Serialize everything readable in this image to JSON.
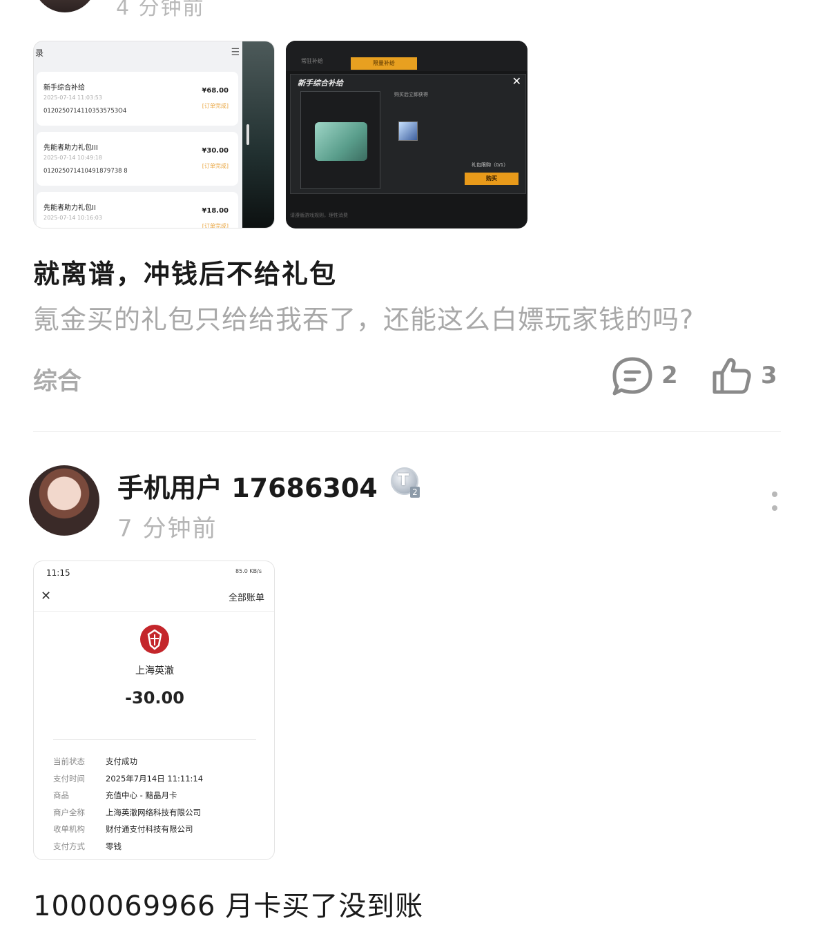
{
  "post1": {
    "time": "4 分钟前",
    "title": "就离谱，冲钱后不给礼包",
    "body": "氪金买的礼包只给给我吞了，还能这么白嫖玩家钱的吗?",
    "category": "综合",
    "comments": "2",
    "likes": "3",
    "image1": {
      "header_label": "录",
      "orders": [
        {
          "name": "新手综合补给",
          "date": "2025-07-14 11:03:53",
          "id": "01202507141103535753O4",
          "price": "¥68.00",
          "status": "[订单完成]"
        },
        {
          "name": "先能者助力礼包III",
          "date": "2025-07-14 10:49:18",
          "id": "012025071410491879738 8",
          "price": "¥30.00",
          "status": "[订单完成]"
        },
        {
          "name": "先能者助力礼包II",
          "date": "2025-07-14 10:16:03",
          "id": "",
          "price": "¥18.00",
          "status": "[订单完成]"
        }
      ]
    },
    "image2": {
      "tab1": "常驻补给",
      "tab2": "限量补给",
      "dialog_title": "新手综合补给",
      "desc": "购买后立即获得",
      "limit": "礼包限购（0/1）",
      "buy": "购买",
      "footer": "请遵循游戏规则，理性消费"
    }
  },
  "post2": {
    "username": "手机用户 17686304",
    "badge": "T",
    "badge_level": "2",
    "time": "7 分钟前",
    "receipt": {
      "time": "11:15",
      "status_icons": "85.0 KB/s",
      "all_bills": "全部账单",
      "merchant": "上海英澈",
      "amount": "-30.00",
      "rows": [
        {
          "k": "当前状态",
          "v": "支付成功"
        },
        {
          "k": "支付时间",
          "v": "2025年7月14日 11:11:14"
        },
        {
          "k": "商品",
          "v": "充值中心 - 黯晶月卡"
        },
        {
          "k": "商户全称",
          "v": "上海英澈网络科技有限公司"
        },
        {
          "k": "收单机构",
          "v": "财付通支付科技有限公司"
        },
        {
          "k": "支付方式",
          "v": "零钱"
        }
      ]
    },
    "text": "1000069966 月卡买了没到账"
  }
}
